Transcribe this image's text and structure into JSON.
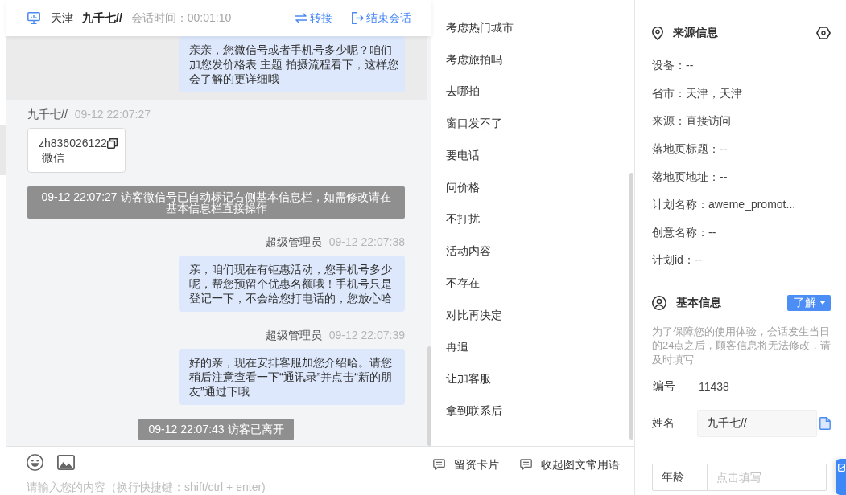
{
  "chat_header": {
    "location": "天津",
    "visitor": "九千七//",
    "session_time": "会话时间：00:01:10",
    "actions": [
      {
        "kind": "transfer",
        "label": "转接"
      },
      {
        "kind": "end",
        "label": "结束会话"
      }
    ]
  },
  "messages": [
    {
      "kind": "agent",
      "highlighted": true,
      "text": "亲亲，您微信号或者手机号多少呢？咱们加您发价格表 主题 拍摄流程看下，这样您会了解的更详细哦"
    },
    {
      "kind": "visitor_card",
      "highlighted": false,
      "sender": "九千七//",
      "time": "09-12 22:07:27",
      "value": "zh836026122",
      "label": "微信"
    },
    {
      "kind": "notice",
      "highlighted": false,
      "text": "09-12 22:07:27 访客微信号已自动标记右侧基本信息栏，如需修改请在基本信息栏直接操作"
    },
    {
      "kind": "agent",
      "highlighted": false,
      "sender": "超级管理员",
      "time": "09-12 22:07:38",
      "text": "亲，咱们现在有钜惠活动，您手机号多少呢，帮您预留个优惠名额哦！手机号只是登记一下，不会给您打电话的，您放心哈"
    },
    {
      "kind": "agent",
      "highlighted": false,
      "sender": "超级管理员",
      "time": "09-12 22:07:39",
      "text": "好的亲，现在安排客服加您介绍哈。请您稍后注意查看一下“通讯录”并点击“新的朋友”通过下哦"
    },
    {
      "kind": "status",
      "highlighted": false,
      "text": "09-12 22:07:43 访客已离开"
    }
  ],
  "composer": {
    "placeholder": "请输入您的内容（换行快捷键：shift/ctrl + enter)"
  },
  "quick_replies": {
    "items": [
      "考虑热门城市",
      "考虑旅拍吗",
      "去哪拍",
      "窗口发不了",
      "要电话",
      "问价格",
      "不打扰",
      "活动内容",
      "不存在",
      "对比再决定",
      "再追",
      "让加客服",
      "拿到联系后"
    ],
    "footer": [
      "留资卡片",
      "收起图文常用语"
    ]
  },
  "source_info": {
    "title": "来源信息",
    "rows": [
      "设备：--",
      "省市：天津，天津",
      "来源：直接访问",
      "落地页标题：--",
      "落地页地址：--",
      "计划名称：aweme_promot...",
      "创意名称：--",
      "计划id：--"
    ]
  },
  "basic_info": {
    "title": "基本信息",
    "badge": "了解",
    "notice": "为了保障您的使用体验，会话发生当日的24点之后，顾客信息将无法修改，请及时填写",
    "fields": [
      {
        "kind": "text",
        "label": "编号",
        "value": "11438"
      },
      {
        "kind": "locked",
        "label": "姓名",
        "value": "九千七//"
      },
      {
        "kind": "input",
        "label": "年龄",
        "placeholder": "点击填写"
      }
    ]
  }
}
